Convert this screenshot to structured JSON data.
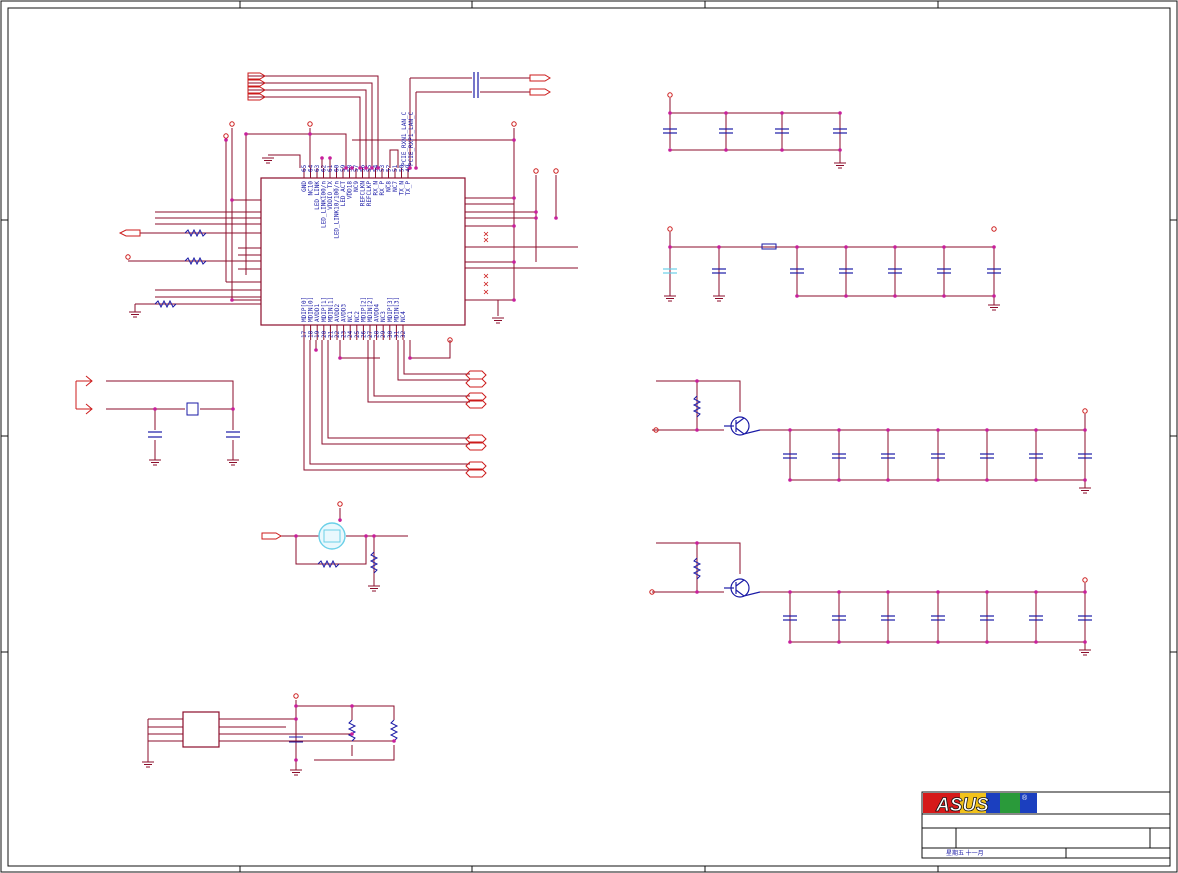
{
  "brand": {
    "logo_text": "ASUS",
    "registered": "®"
  },
  "chip": {
    "top_pins": [
      {
        "num": "65",
        "name": "GND"
      },
      {
        "num": "64",
        "name": "NC10"
      },
      {
        "num": "63",
        "name": "LED_LINK"
      },
      {
        "num": "62",
        "name": "LED_LINK100/n"
      },
      {
        "num": "61",
        "name": "VDDIO_TX"
      },
      {
        "num": "60",
        "name": "LED_LINK10/100/n"
      },
      {
        "num": "59",
        "name": "LED_ACT"
      },
      {
        "num": "58",
        "name": "VDD18"
      },
      {
        "num": "57",
        "name": "NC9"
      },
      {
        "num": "56",
        "name": "REFCLKN"
      },
      {
        "num": "55",
        "name": "REFCLKP"
      },
      {
        "num": "54",
        "name": "RX_N"
      },
      {
        "num": "53",
        "name": "RX_P"
      },
      {
        "num": "52",
        "name": "NC8"
      },
      {
        "num": "51",
        "name": "NC7"
      },
      {
        "num": "50",
        "name": "TX_N"
      },
      {
        "num": "49",
        "name": "TX_P"
      }
    ],
    "bottom_pins": [
      {
        "num": "17",
        "name": "MDIP[0]"
      },
      {
        "num": "18",
        "name": "MDIN[0]"
      },
      {
        "num": "19",
        "name": "AVDD1"
      },
      {
        "num": "20",
        "name": "MDIP[1]"
      },
      {
        "num": "21",
        "name": "MDIN[1]"
      },
      {
        "num": "22",
        "name": "AVDD2"
      },
      {
        "num": "23",
        "name": "AVDD3"
      },
      {
        "num": "24",
        "name": "NC1"
      },
      {
        "num": "25",
        "name": "NC2"
      },
      {
        "num": "26",
        "name": "MDIP[2]"
      },
      {
        "num": "27",
        "name": "MDIN[2]"
      },
      {
        "num": "28",
        "name": "AVDD4"
      },
      {
        "num": "29",
        "name": "NC3"
      },
      {
        "num": "30",
        "name": "MDIP[3]"
      },
      {
        "num": "31",
        "name": "MDIN[3]"
      },
      {
        "num": "32",
        "name": "NC4"
      }
    ]
  },
  "nets": {
    "rx_lan": "PCIE_RXN1_LAN_C",
    "rx_lan_p": "PCIE_RXP1_LAN_C"
  },
  "title_block": {
    "date_label": "星期五 十一月"
  },
  "colors": {
    "wire": "#8b0d2b",
    "junction": "#c81f9c",
    "pin_text": "#1a1aa6",
    "power": "#cc1b1b",
    "border": "#111111",
    "led": "#6ad0e8"
  }
}
